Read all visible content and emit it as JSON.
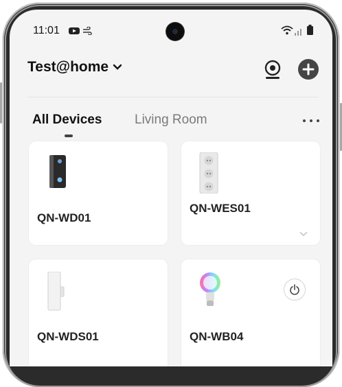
{
  "status_bar": {
    "time": "11:01",
    "left_icons": [
      "youtube-icon",
      "wind-icon"
    ],
    "right_icons": [
      "wifi-icon",
      "signal-icon",
      "battery-icon"
    ]
  },
  "header": {
    "home_name": "Test@home",
    "home_dropdown_icon": "chevron-down-icon",
    "camera_icon": "camera-icon",
    "add_icon": "add-circle-icon"
  },
  "tabs": {
    "items": [
      {
        "label": "All Devices",
        "active": true
      },
      {
        "label": "Living Room",
        "active": false
      }
    ],
    "more_icon": "more-horizontal-icon"
  },
  "devices": [
    {
      "name": "QN-WD01",
      "image": "video-doorbell-icon",
      "has_power": false,
      "has_expand": false
    },
    {
      "name": "QN-WES01",
      "image": "power-strip-icon",
      "has_power": false,
      "has_expand": true
    },
    {
      "name": "QN-WDS01",
      "image": "door-sensor-icon",
      "has_power": false,
      "has_expand": false
    },
    {
      "name": "QN-WB04",
      "image": "smart-bulb-icon",
      "has_power": true,
      "has_expand": false
    }
  ],
  "colors": {
    "background": "#f4f4f4",
    "card": "#ffffff",
    "accent": "#111111",
    "muted_text": "#7a7a7a",
    "add_button": "#444444"
  }
}
